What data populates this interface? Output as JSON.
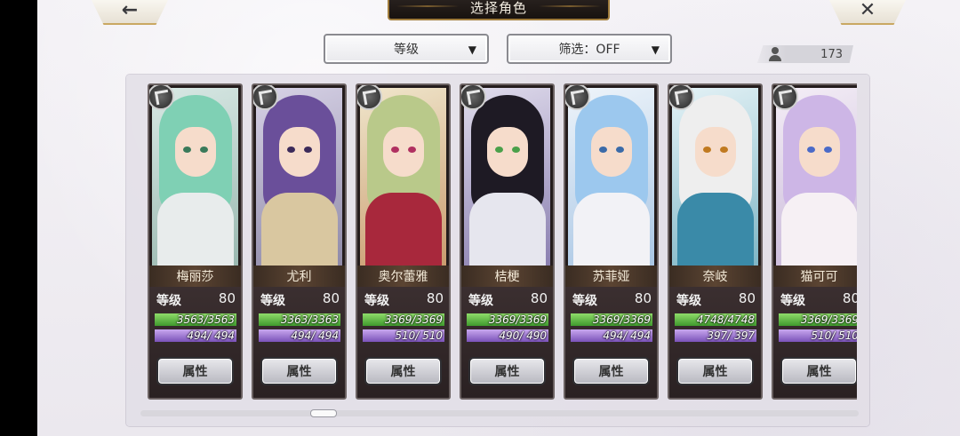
{
  "header": {
    "title": "选择角色",
    "back_icon": "←",
    "close_icon": "✕"
  },
  "filters": {
    "sort_label": "等级",
    "filter_label": "筛选：OFF",
    "caret": "▼"
  },
  "roster": {
    "count": "173"
  },
  "stat_labels": {
    "level": "等级",
    "attr_button": "属性"
  },
  "characters": [
    {
      "name": "梅丽莎",
      "level": "80",
      "hp": "3563/3563",
      "mp": "494/  494"
    },
    {
      "name": "尤利",
      "level": "80",
      "hp": "3363/3363",
      "mp": "494/  494"
    },
    {
      "name": "奥尔蕾雅",
      "level": "80",
      "hp": "3369/3369",
      "mp": "510/  510"
    },
    {
      "name": "桔梗",
      "level": "80",
      "hp": "3369/3369",
      "mp": "490/  490"
    },
    {
      "name": "苏菲娅",
      "level": "80",
      "hp": "3369/3369",
      "mp": "494/  494"
    },
    {
      "name": "奈岐",
      "level": "80",
      "hp": "4748/4748",
      "mp": "397/  397"
    },
    {
      "name": "猫可可",
      "level": "80",
      "hp": "3369/3369",
      "mp": "510/  510"
    }
  ],
  "colors": {
    "hp_bar": "#4fb33a",
    "mp_bar": "#8f66c8",
    "name_plate": "#4a372a",
    "frame_gold": "#c9a862"
  }
}
